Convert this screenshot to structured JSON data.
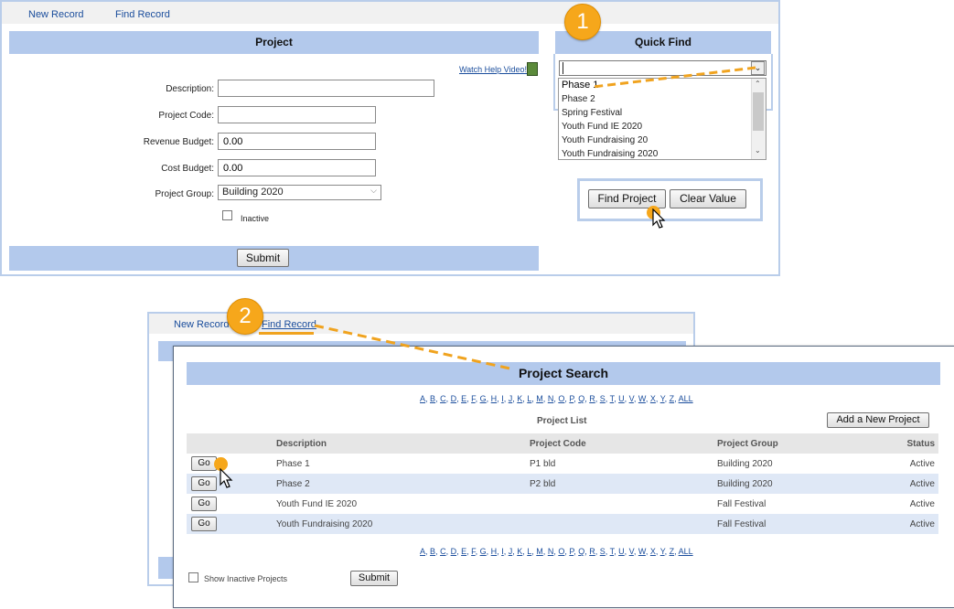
{
  "top": {
    "nav": {
      "new_record": "New Record",
      "find_record": "Find Record"
    },
    "project": {
      "title": "Project",
      "watch_help": "Watch Help Video!",
      "description_label": "Description:",
      "description_value": "",
      "code_label": "Project Code:",
      "code_value": "",
      "revenue_label": "Revenue Budget:",
      "revenue_value": "0.00",
      "cost_label": "Cost Budget:",
      "cost_value": "0.00",
      "group_label": "Project Group:",
      "group_value": "Building 2020",
      "inactive_label": "Inactive",
      "submit_label": "Submit"
    },
    "quick_find": {
      "title": "Quick Find",
      "input_value": "",
      "options": [
        "Phase 1",
        "Phase 2",
        "Spring Festival",
        "Youth Fund IE 2020",
        "Youth Fundraising 20",
        "Youth Fundraising 2020"
      ],
      "find_label": "Find Project",
      "clear_label": "Clear Value"
    },
    "badge": "1"
  },
  "bottom": {
    "badge": "2",
    "nav": {
      "new_record": "New Record",
      "find_record": "Find Record"
    },
    "search": {
      "title": "Project Search",
      "alphabet": [
        "A",
        "B",
        "C",
        "D",
        "E",
        "F",
        "G",
        "H",
        "I",
        "J",
        "K",
        "L",
        "M",
        "N",
        "O",
        "P",
        "Q",
        "R",
        "S",
        "T",
        "U",
        "V",
        "W",
        "X",
        "Y",
        "Z",
        "ALL"
      ],
      "list_label": "Project List",
      "add_button": "Add a New Project",
      "columns": {
        "description": "Description",
        "code": "Project Code",
        "group": "Project Group",
        "status": "Status"
      },
      "go_label": "Go",
      "rows": [
        {
          "description": "Phase 1",
          "code": "P1 bld",
          "group": "Building 2020",
          "status": "Active"
        },
        {
          "description": "Phase 2",
          "code": "P2 bld",
          "group": "Building 2020",
          "status": "Active"
        },
        {
          "description": "Youth Fund IE 2020",
          "code": "",
          "group": "Fall Festival",
          "status": "Active"
        },
        {
          "description": "Youth Fundraising 2020",
          "code": "",
          "group": "Fall Festival",
          "status": "Active"
        }
      ],
      "show_inactive_label": "Show Inactive Projects",
      "submit_label": "Submit"
    }
  },
  "colors": {
    "header_bar": "#b3c9ec",
    "panel_border": "#b9cdea",
    "badge": "#f6a71b",
    "link": "#1a4d9c"
  }
}
